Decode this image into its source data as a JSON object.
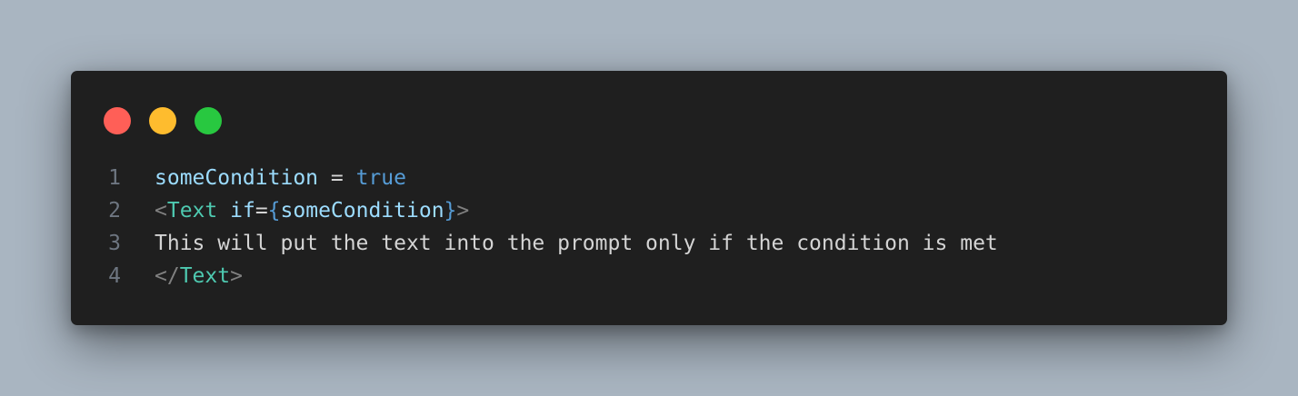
{
  "colors": {
    "background": "#a9b5c1",
    "window": "#1f1f1f",
    "close": "#ff5f57",
    "minimize": "#febc2e",
    "zoom": "#28c840"
  },
  "window_controls": [
    {
      "name": "close",
      "color": "#ff5f57"
    },
    {
      "name": "minimize",
      "color": "#febc2e"
    },
    {
      "name": "zoom",
      "color": "#28c840"
    }
  ],
  "code": {
    "lines": [
      {
        "number": "1",
        "tokens": [
          {
            "text": "someCondition",
            "kind": "var"
          },
          {
            "text": " = ",
            "kind": "op"
          },
          {
            "text": "true",
            "kind": "kw"
          }
        ]
      },
      {
        "number": "2",
        "tokens": [
          {
            "text": "<",
            "kind": "punct"
          },
          {
            "text": "Text",
            "kind": "tag"
          },
          {
            "text": " ",
            "kind": "text"
          },
          {
            "text": "if",
            "kind": "attr"
          },
          {
            "text": "=",
            "kind": "op"
          },
          {
            "text": "{",
            "kind": "brace"
          },
          {
            "text": "someCondition",
            "kind": "var"
          },
          {
            "text": "}",
            "kind": "brace"
          },
          {
            "text": ">",
            "kind": "punct"
          }
        ]
      },
      {
        "number": "3",
        "tokens": [
          {
            "text": "This will put the text into the prompt only if the condition is met",
            "kind": "text"
          }
        ]
      },
      {
        "number": "4",
        "tokens": [
          {
            "text": "</",
            "kind": "punct"
          },
          {
            "text": "Text",
            "kind": "tag"
          },
          {
            "text": ">",
            "kind": "punct"
          }
        ]
      }
    ]
  }
}
